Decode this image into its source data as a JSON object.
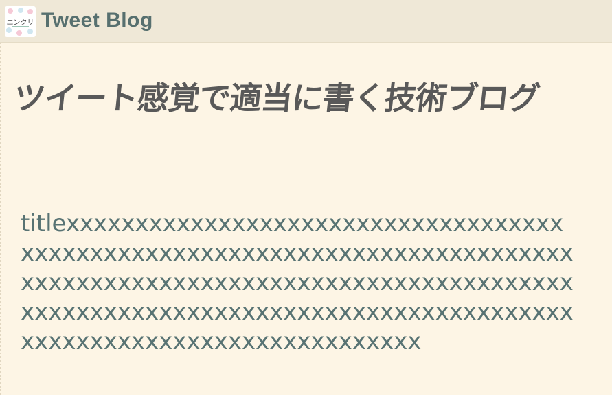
{
  "header": {
    "logo_text": "エンクリ",
    "site_title": "Tweet Blog"
  },
  "tagline": "ツイート感覚で適当に書く技術ブログ",
  "post": {
    "title": "titlexxxxxxxxxxxxxxxxxxxxxxxxxxxxxxxxxxxxxxxxxxxxxxxxxxxxxxxxxxxxxxxxxxxxxxxxxxxxxxxxxxxxxxxxxxxxxxxxxxxxxxxxxxxxxxxxxxxxxxxxxxxxxxxxxxxxxxxxxxxxxxxxxxxxxxxxxxxxxxxxxxxxxxxxxxxxxxxxxxxxxxxxx"
  },
  "colors": {
    "page_background": "#fdf5e5",
    "header_background": "#efe8d7",
    "site_title": "#57706f",
    "tagline": "#595959",
    "post_title": "#587373"
  }
}
